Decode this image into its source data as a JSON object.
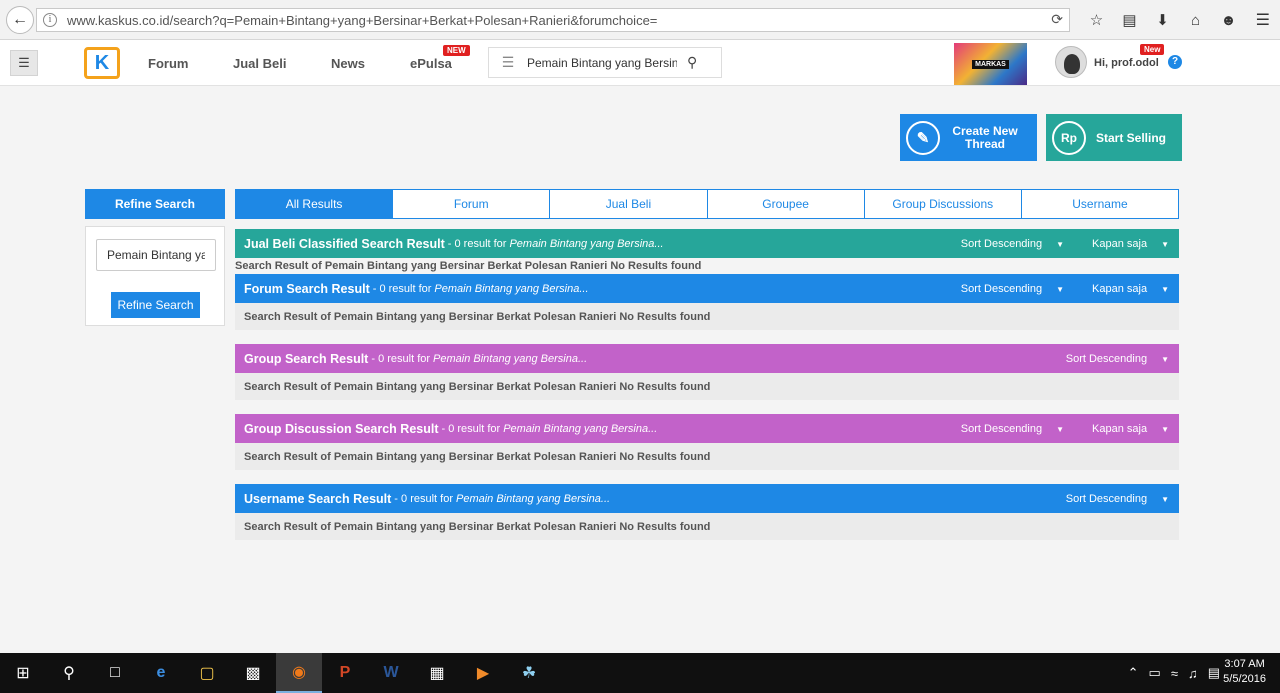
{
  "browser": {
    "url": "www.kaskus.co.id/search?q=Pemain+Bintang+yang+Bersinar+Berkat+Polesan+Ranieri&forumchoice=",
    "icons": [
      "back-icon",
      "info-icon",
      "reload-icon",
      "star-icon",
      "reader-icon",
      "download-icon",
      "home-icon",
      "smiley-icon",
      "menu-icon"
    ]
  },
  "header": {
    "logo_text": "K",
    "nav": [
      "Forum",
      "Jual Beli",
      "News",
      "ePulsa"
    ],
    "epulsa_badge": "NEW",
    "search_value": "Pemain Bintang yang Bersinar Berkat Polesan Ranieri",
    "banner_text": "MARKAS",
    "user_greeting": "Hi, prof.odol",
    "user_badge": "New",
    "help": "?"
  },
  "actions": {
    "create_thread": "Create New Thread",
    "start_selling": "Start Selling"
  },
  "refine": {
    "title": "Refine Search",
    "input_value": "Pemain Bintang yang Bersinar Berkat Polesan Ranieri",
    "button": "Refine Search"
  },
  "tabs": [
    "All Results",
    "Forum",
    "Jual Beli",
    "Groupee",
    "Group Discussions",
    "Username"
  ],
  "results": [
    {
      "title": "Jual Beli Classified Search Result",
      "count": "- 0 result for",
      "query": "Pemain Bintang yang Bersina...",
      "sort": "Sort Descending",
      "time": "Kapan saja",
      "message": "Search Result of Pemain Bintang yang Bersinar Berkat Polesan Ranieri No Results found",
      "color": "#26a69a"
    },
    {
      "title": "Forum Search Result",
      "count": "- 0 result for",
      "query": "Pemain Bintang yang Bersina...",
      "sort": "Sort Descending",
      "time": "Kapan saja",
      "message": "Search Result of Pemain Bintang yang Bersinar Berkat Polesan Ranieri No Results found",
      "color": "#1e88e5"
    },
    {
      "title": "Group Search Result",
      "count": "- 0 result for",
      "query": "Pemain Bintang yang Bersina...",
      "sort": "Sort Descending",
      "message": "Search Result of Pemain Bintang yang Bersinar Berkat Polesan Ranieri No Results found",
      "color": "#c262c9"
    },
    {
      "title": "Group Discussion Search Result",
      "count": "- 0 result for",
      "query": "Pemain Bintang yang Bersina...",
      "sort": "Sort Descending",
      "time": "Kapan saja",
      "message": "Search Result of Pemain Bintang yang Bersinar Berkat Polesan Ranieri No Results found",
      "color": "#c262c9"
    },
    {
      "title": "Username Search Result",
      "count": "- 0 result for",
      "query": "Pemain Bintang yang Bersina...",
      "sort": "Sort Descending",
      "message": "Search Result of Pemain Bintang yang Bersinar Berkat Polesan Ranieri No Results found",
      "color": "#1e88e5"
    }
  ],
  "taskbar": {
    "apps": [
      "start-icon",
      "search-icon",
      "task-view-icon",
      "edge-icon",
      "file-explorer-icon",
      "store-icon",
      "firefox-icon",
      "powerpoint-icon",
      "word-icon",
      "video-editor-icon",
      "media-player-icon",
      "paint-icon"
    ],
    "time": "3:07 AM",
    "date": "5/5/2016"
  }
}
